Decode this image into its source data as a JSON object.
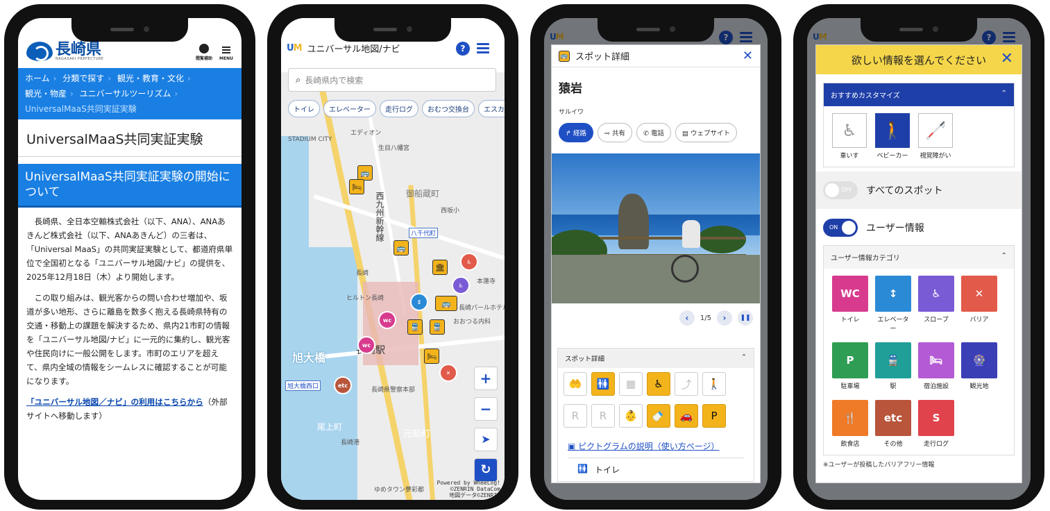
{
  "phone1": {
    "logo": {
      "text": "長崎県",
      "sub": "NAGASAKI PREFECTURE"
    },
    "tools": [
      {
        "label": "閲覧補助",
        "icon": "accessibility-icon"
      },
      {
        "label": "MENU",
        "icon": "menu-icon"
      }
    ],
    "breadcrumb": [
      "ホーム",
      "分類で探す",
      "観光・教育・文化",
      "観光・物産",
      "ユニバーサルツーリズム",
      "UniversalMaaS共同実証実験"
    ],
    "page_title": "UniversalMaaS共同実証実験",
    "subheading": "UniversalMaaS共同実証実験の開始について",
    "paragraph1": "長崎県、全日本空輸株式会社（以下、ANA）、ANAあきんど株式会社（以下、ANAあきんど）の三者は、「Universal MaaS」の共同実証実験として、都道府県単位で全国初となる「ユニバーサル地図/ナビ」の提供を、2025年12月18日（木）より開始します。",
    "paragraph2": "この取り組みは、観光客からの問い合わせ増加や、坂道が多い地形、さらに離島を数多く抱える長崎県特有の交通・移動上の課題を解決するため、県内21市町の情報を「ユニバーサル地図/ナビ」に一元的に集約し、観光客や住民向けに一般公開をします。市町のエリアを超えて、県内全域の情報をシームレスに確認することが可能になります。",
    "link_text": "「ユニバーサル地図／ナビ」の利用はこちらから",
    "link_note": "（外部サイトへ移動します）"
  },
  "phone2": {
    "app_title": "ユニバーサル地図/ナビ",
    "search_placeholder": "長崎県内で検索",
    "chips": [
      "トイレ",
      "エレベーター",
      "走行ログ",
      "おむつ交換台",
      "エスカレー"
    ],
    "map_labels": [
      "STADIUM CITY",
      "エディオン",
      "生目八幡宮",
      "西九州新幹線",
      "御船蔵町",
      "八千代町",
      "西坂小",
      "長崎",
      "本蓮寺",
      "ヒルトン長崎",
      "長崎パールホテル",
      "おおつる内科",
      "長崎駅",
      "旭大橋",
      "旭大橋西口",
      "長崎県警察本部",
      "尾上町",
      "元船町",
      "長崎港",
      "ゆめタウン夢彩都"
    ],
    "big_labels": [
      "旭大橋"
    ],
    "attribution": [
      "Powered by WheeLog!",
      "©ZENRIN DataCom",
      "地図データ©ZENRIN"
    ],
    "zoom_in": "+",
    "zoom_out": "−",
    "help": "?"
  },
  "phone3": {
    "header_title": "スポット詳細",
    "spot_name": "猿岩",
    "spot_kana": "サルイワ",
    "actions": [
      "経路",
      "共有",
      "電話",
      "ウェブサイト"
    ],
    "pager": "1/5",
    "detail_header": "スポット詳細",
    "pictogram_link": "ピクトグラムの説明（使い方ページ）",
    "toilet_label": "トイレ",
    "pictograms_row1": [
      false,
      true,
      false,
      true,
      false,
      false
    ],
    "pictograms_row2": [
      false,
      false,
      false,
      true,
      true,
      true
    ]
  },
  "phone4": {
    "header_title": "欲しい情報を選んでください",
    "recommend_header": "おすすめカスタマイズ",
    "recommend": [
      {
        "label": "車いす",
        "selected": false
      },
      {
        "label": "ベビーカー",
        "selected": true
      },
      {
        "label": "視覚障がい",
        "selected": false
      }
    ],
    "all_spots_toggle": {
      "label": "すべてのスポット",
      "state": "OFF"
    },
    "user_info_toggle": {
      "label": "ユーザー情報",
      "state": "ON"
    },
    "category_header": "ユーザー情報カテゴリ",
    "categories": [
      {
        "label": "トイレ",
        "glyph": "WC",
        "color": "#d83b8e"
      },
      {
        "label": "エレベーター",
        "glyph": "↕",
        "color": "#2b8ad6"
      },
      {
        "label": "スロープ",
        "glyph": "♿",
        "color": "#7a5bd6"
      },
      {
        "label": "バリア",
        "glyph": "✕",
        "color": "#e25a4a"
      },
      {
        "label": "駐車場",
        "glyph": "P",
        "color": "#2f9d53"
      },
      {
        "label": "駅",
        "glyph": "🚆",
        "color": "#1f9f97"
      },
      {
        "label": "宿泊施設",
        "glyph": "🛏",
        "color": "#b45ad4"
      },
      {
        "label": "観光地",
        "glyph": "🎡",
        "color": "#3b3fb5"
      },
      {
        "label": "飲食店",
        "glyph": "🍴",
        "color": "#ef7a28"
      },
      {
        "label": "その他",
        "glyph": "etc",
        "color": "#b8553a"
      },
      {
        "label": "走行ログ",
        "glyph": "S",
        "color": "#e0434b"
      }
    ],
    "note": "※ユーザーが投稿したバリアフリー情報"
  }
}
